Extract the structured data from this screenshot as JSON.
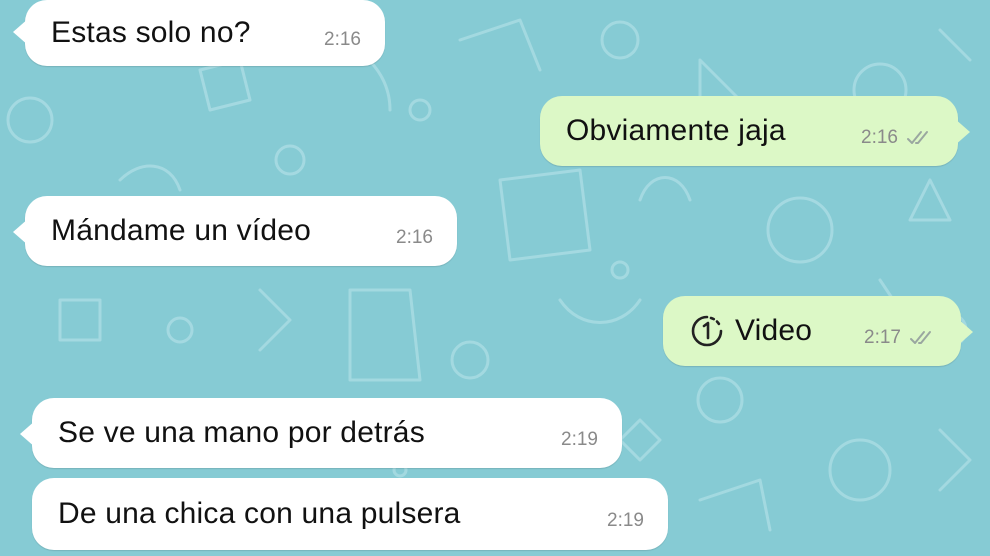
{
  "colors": {
    "wallpaper": "#86cbd4",
    "incoming_bubble": "#ffffff",
    "outgoing_bubble": "#dcf8c6",
    "timestamp": "#8a8a8a",
    "text": "#111111"
  },
  "messages": [
    {
      "direction": "incoming",
      "text": "Estas solo no?",
      "time": "2:16"
    },
    {
      "direction": "outgoing",
      "text": "Obviamente jaja",
      "time": "2:16",
      "status_icon": "double-check-icon"
    },
    {
      "direction": "incoming",
      "text": "Mándame un vídeo",
      "time": "2:16"
    },
    {
      "direction": "outgoing",
      "text": "Video",
      "time": "2:17",
      "status_icon": "double-check-icon",
      "media_icon": "view-once-video-icon"
    },
    {
      "direction": "incoming",
      "text": "Se ve una mano por detrás",
      "time": "2:19"
    },
    {
      "direction": "incoming",
      "text": "De una chica con una pulsera",
      "time": "2:19"
    }
  ]
}
